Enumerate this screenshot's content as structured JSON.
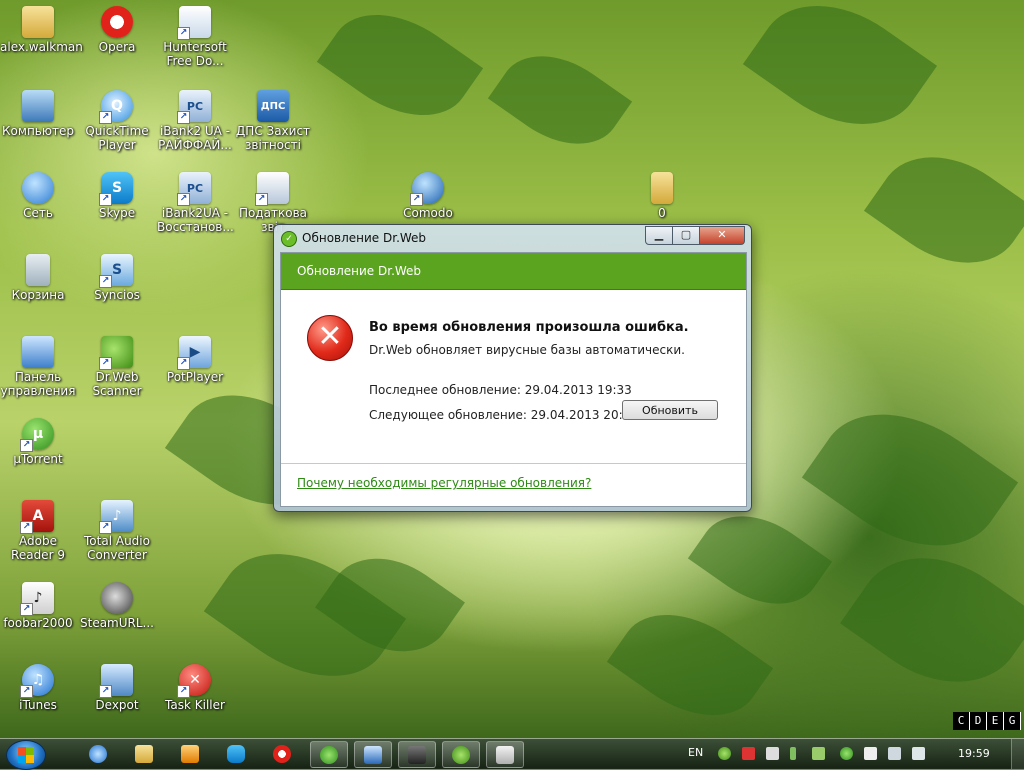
{
  "desktop": {
    "icons": [
      {
        "label": "alex.walkman",
        "icon": "user-folder-icon"
      },
      {
        "label": "Opera",
        "icon": "opera-icon"
      },
      {
        "label": "Huntersoft Free Do...",
        "icon": "huntersoft-icon"
      },
      {
        "label": "Компьютер",
        "icon": "computer-icon"
      },
      {
        "label": "QuickTime Player",
        "icon": "quicktime-icon"
      },
      {
        "label": "iBank2 UA - РАЙФФАЙ...",
        "icon": "ibank-icon"
      },
      {
        "label": "ДПС Захист звітності",
        "icon": "dps-icon"
      },
      {
        "label": "Сеть",
        "icon": "network-icon"
      },
      {
        "label": "Skype",
        "icon": "skype-icon"
      },
      {
        "label": "iBank2UA - Восстанов...",
        "icon": "ibank-restore-icon"
      },
      {
        "label": "Податкова звіт",
        "icon": "tax-report-icon"
      },
      {
        "label": "Comodo",
        "icon": "comodo-icon"
      },
      {
        "label": "0",
        "icon": "folder-icon"
      },
      {
        "label": "Корзина",
        "icon": "recycle-bin-icon"
      },
      {
        "label": "Syncios",
        "icon": "syncios-icon"
      },
      {
        "label": "Панель управления",
        "icon": "control-panel-icon"
      },
      {
        "label": "Dr.Web Scanner",
        "icon": "drweb-scanner-icon"
      },
      {
        "label": "PotPlayer",
        "icon": "potplayer-icon"
      },
      {
        "label": "µTorrent",
        "icon": "utorrent-icon"
      },
      {
        "label": "Adobe Reader 9",
        "icon": "adobe-reader-icon"
      },
      {
        "label": "Total Audio Converter",
        "icon": "audio-converter-icon"
      },
      {
        "label": "foobar2000",
        "icon": "foobar-icon"
      },
      {
        "label": "SteamURL...",
        "icon": "steam-icon"
      },
      {
        "label": "iTunes",
        "icon": "itunes-icon"
      },
      {
        "label": "Dexpot",
        "icon": "dexpot-icon"
      },
      {
        "label": "Task Killer",
        "icon": "task-killer-icon"
      }
    ]
  },
  "dialog": {
    "title": "Обновление Dr.Web",
    "header": "Обновление Dr.Web",
    "message": "Во время обновления произошла ошибка.",
    "submessage": "Dr.Web обновляет вирусные базы автоматически.",
    "last_update_label": "Последнее обновление:",
    "last_update_value": "29.04.2013 19:33",
    "next_update_label": "Следующее обновление:",
    "next_update_value": "29.04.2013 20:03",
    "update_button": "Обновить",
    "help_link": "Почему необходимы регулярные обновления?",
    "accent_color": "#5aa41f"
  },
  "taskbar": {
    "language": "EN",
    "clock": "19:59",
    "cdeg_letters": [
      "C",
      "D",
      "E",
      "G"
    ]
  }
}
